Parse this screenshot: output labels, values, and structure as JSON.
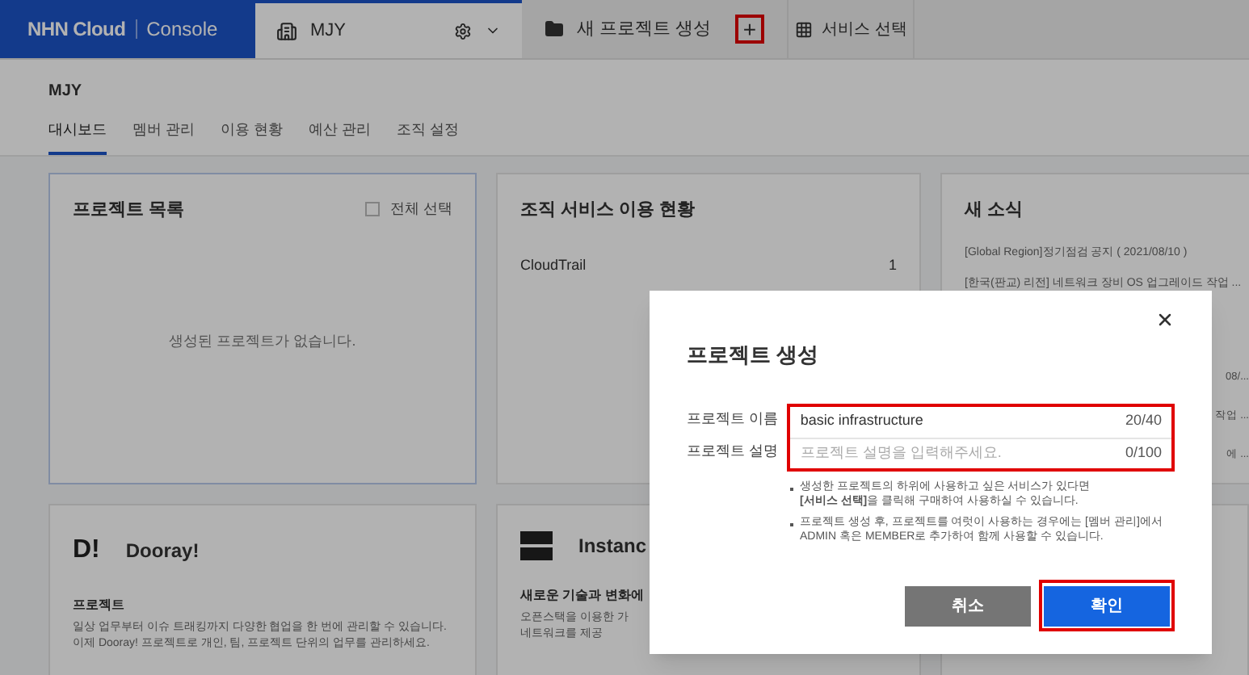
{
  "topbar": {
    "logo": "NHN Cloud",
    "logo_suffix": "Console",
    "org_tab": {
      "label": "MJY"
    },
    "project_tab": {
      "label": "새 프로젝트 생성",
      "add_highlighted": true,
      "add_symbol": "+"
    },
    "service_tab": {
      "label": "서비스 선택"
    }
  },
  "org_title": "MJY",
  "tabs": [
    {
      "label": "대시보드",
      "selected": true
    },
    {
      "label": "멤버 관리",
      "selected": false
    },
    {
      "label": "이용 현황",
      "selected": false
    },
    {
      "label": "예산 관리",
      "selected": false
    },
    {
      "label": "조직 설정",
      "selected": false
    }
  ],
  "project_list": {
    "title": "프로젝트 목록",
    "select_all": {
      "label": "전체 선택",
      "checked": false
    },
    "empty_text": "생성된 프로젝트가 없습니다.",
    "selected": true
  },
  "service_usage": {
    "title": "조직 서비스 이용 현황",
    "rows": [
      {
        "name": "CloudTrail",
        "count": "1"
      }
    ]
  },
  "news": {
    "title": "새 소식",
    "items": [
      "[Global Region]정기점검 공지 ( 2021/08/10 )",
      "[한국(판교) 리전] 네트워크 장비 OS 업그레이드 작업 ..."
    ],
    "partial_items": [
      "08/...",
      "작업 ...",
      "에 ..."
    ]
  },
  "service_cards": [
    {
      "kind": "dooray",
      "logo": "D!",
      "title": "Dooray!",
      "subtitle": "프로젝트",
      "description": "일상 업무부터 이슈 트래킹까지 다양한 협업을 한 번에 관리할 수 있습니다.\n이제 Dooray! 프로젝트로 개인, 팀, 프로젝트 단위의 업무를 관리하세요."
    },
    {
      "kind": "instance",
      "title": "Instanc",
      "subtitle": "새로운 기술과 변화에",
      "description": "오픈스택을 이용한 가\n네트워크를 제공"
    }
  ],
  "modal": {
    "title": "프로젝트 생성",
    "fields": [
      {
        "label": "프로젝트 이름",
        "value": "basic infrastructure",
        "counter": "20/40"
      },
      {
        "label": "프로젝트 설명",
        "placeholder": "프로젝트 설명을 입력해주세요.",
        "counter": "0/100"
      }
    ],
    "fields_highlighted": true,
    "notes": [
      "생성한 프로젝트의 하위에 사용하고 싶은 서비스가 있다면\n**[서비스 선택]**을 클릭해 구매하여 사용하실 수 있습니다.",
      "프로젝트 생성 후, 프로젝트를 여럿이 사용하는 경우에는 [멤버 관리]에서\nADMIN 혹은 MEMBER로 추가하여 함께 사용할 수 있습니다."
    ],
    "buttons": [
      {
        "kind": "cancel",
        "label": "취소",
        "highlighted": false
      },
      {
        "kind": "confirm",
        "label": "확인",
        "highlighted": true
      }
    ]
  }
}
